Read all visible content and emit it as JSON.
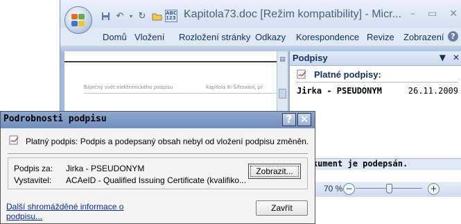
{
  "window": {
    "title": "Kapitola73.doc [Režim kompatibility] - Micr...",
    "minimize_glyph": "–",
    "maximize_glyph": "▭",
    "close_glyph": "✕"
  },
  "quick_access": {
    "save_icon": "save-icon",
    "undo_icon": "undo-icon",
    "redo_icon": "redo-icon",
    "open_icon": "open-folder-icon",
    "spelling_icon": "spelling-icon",
    "customize_icon": "chevron-down-icon"
  },
  "ribbon": {
    "tabs": [
      "Domů",
      "Vložení",
      "Rozložení stránky",
      "Odkazy",
      "Korespondence",
      "Revize",
      "Zobrazení"
    ]
  },
  "document": {
    "header_left": "Báječný svět elektronického podpisu",
    "header_right": "Kapitola 8: Šifrování, př"
  },
  "pane": {
    "title": "Podpisy",
    "section_label": "Platné podpisy:",
    "signature": {
      "name": "Jirka - PSEUDONYM",
      "date": "26.11.2009"
    },
    "footer_text": "o dokument je podepsán."
  },
  "statusbar": {
    "zoom": "70 %",
    "zoom_level_percent": 70
  },
  "dialog": {
    "title": "Podrobnosti podpisu",
    "help_glyph": "?",
    "close_glyph": "✕",
    "status_text": "Platný podpis: Podpis a podepsaný obsah nebyl od vložení podpisu změněn.",
    "signed_by_label": "Podpis za:",
    "signed_by_value": "Jirka - PSEUDONYM",
    "issuer_label": "Vystavitel:",
    "issuer_value": "ACAeID - Qualified Issuing Certificate (kvalifiko...",
    "view_button": "Zobrazit...",
    "more_info_link": "Další shromážděné informace o podpisu...",
    "close_button": "Zavřít"
  },
  "colors": {
    "ribbon_bg": "#dfe8f5",
    "dialog_title_bg": "#6f8ebd",
    "link": "#0a2d8c"
  }
}
